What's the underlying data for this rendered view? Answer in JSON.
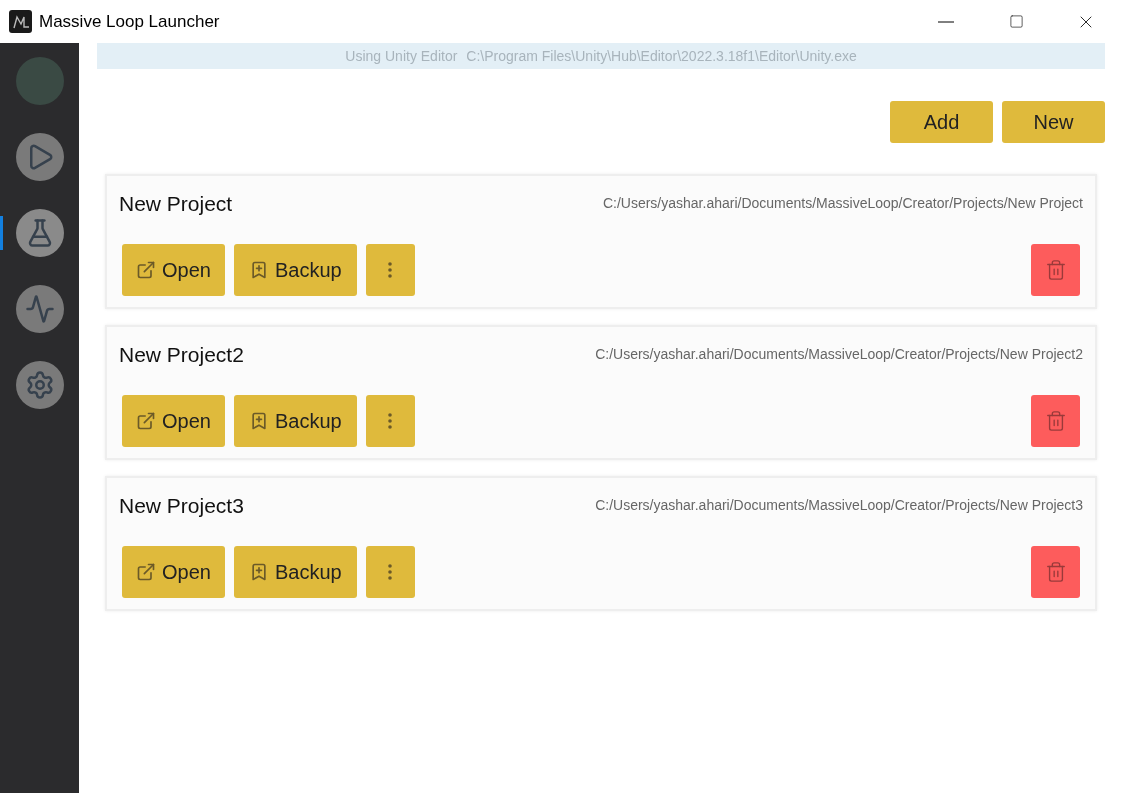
{
  "window": {
    "title": "Massive Loop Launcher"
  },
  "sidebar": {
    "items": [
      {
        "kind": "play",
        "selected": false
      },
      {
        "kind": "flask",
        "selected": true
      },
      {
        "kind": "activity",
        "selected": false
      },
      {
        "kind": "settings",
        "selected": false
      }
    ]
  },
  "banner": {
    "label": "Using Unity Editor",
    "path": "C:\\Program Files\\Unity\\Hub\\Editor\\2022.3.18f1\\Editor\\Unity.exe"
  },
  "top_buttons": [
    "Add",
    "New"
  ],
  "projects": [
    {
      "name": "New Project",
      "path": "C:/Users/yashar.ahari/Documents/MassiveLoop/Creator/Projects/New Project",
      "open": "Open",
      "backup": "Backup"
    },
    {
      "name": "New Project2",
      "path": "C:/Users/yashar.ahari/Documents/MassiveLoop/Creator/Projects/New Project2",
      "open": "Open",
      "backup": "Backup"
    },
    {
      "name": "New Project3",
      "path": "C:/Users/yashar.ahari/Documents/MassiveLoop/Creator/Projects/New Project3",
      "open": "Open",
      "backup": "Backup"
    }
  ]
}
